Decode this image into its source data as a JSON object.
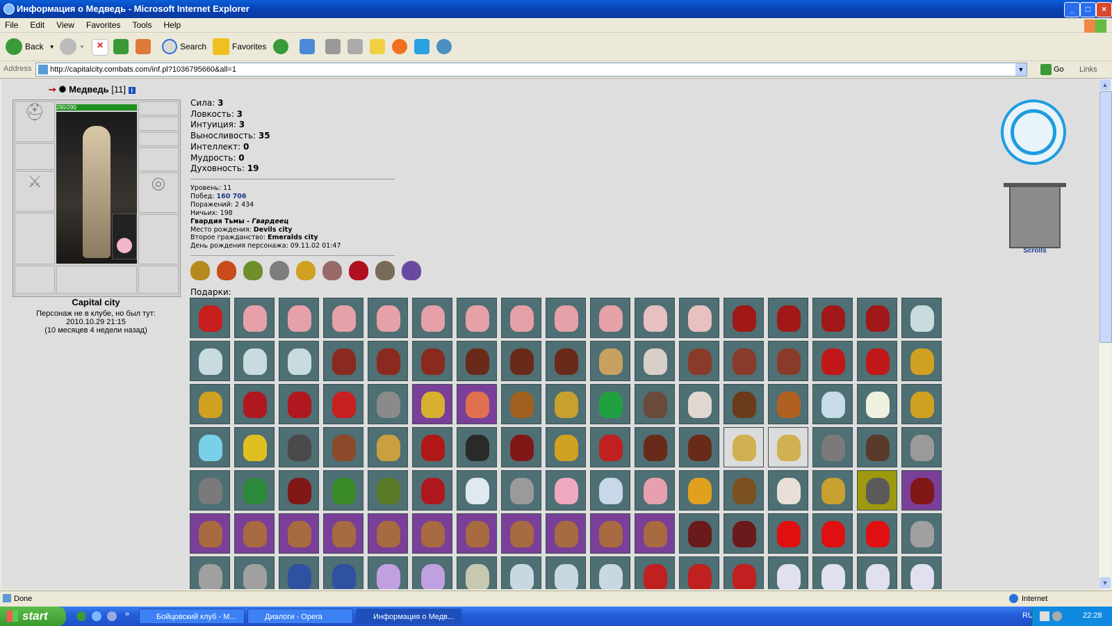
{
  "window": {
    "title": "Информация о Медведь - Microsoft Internet Explorer",
    "controls": [
      "_",
      "□",
      "×"
    ]
  },
  "menu": [
    "File",
    "Edit",
    "View",
    "Favorites",
    "Tools",
    "Help"
  ],
  "toolbar": {
    "back": "Back",
    "search": "Search",
    "favorites": "Favorites",
    "icons": [
      "back-icon",
      "forward-icon",
      "stop-icon",
      "refresh-icon",
      "home-icon",
      "search-icon",
      "favorites-icon",
      "history-icon",
      "mail-icon",
      "print-icon",
      "edit-icon",
      "notes-icon",
      "messenger-icon",
      "skype-icon",
      "people-icon"
    ]
  },
  "address": {
    "label": "Address",
    "url": "http://capitalcity.combats.com/inf.pl?1036795660&all=1",
    "go": "Go",
    "links": "Links"
  },
  "character": {
    "name": "Медведь",
    "level": "[11]",
    "hp": "290/290",
    "city": "Capital city",
    "status_line1": "Персонаж не в клубе, но был тут:",
    "status_line2": "2010.10.29 21:15",
    "status_line3": "(10 месяцев 4 недели назад)",
    "stats": [
      {
        "label": "Сила:",
        "value": "3"
      },
      {
        "label": "Ловкость:",
        "value": "3"
      },
      {
        "label": "Интуиция:",
        "value": "3"
      },
      {
        "label": "Выносливость:",
        "value": "35"
      },
      {
        "label": "Интеллект:",
        "value": "0"
      },
      {
        "label": "Мудрость:",
        "value": "0"
      },
      {
        "label": "Духовность:",
        "value": "19"
      }
    ],
    "details": [
      {
        "label": "Уровень:",
        "value": "11"
      },
      {
        "label": "Побед:",
        "value": "160 706"
      },
      {
        "label": "Поражений:",
        "value": "2 434"
      },
      {
        "label": "Ничьих:",
        "value": "198"
      },
      {
        "label": "Гвардия Тьмы - ",
        "value": "Гвардеец"
      },
      {
        "label": "Место рождения:",
        "value": "Devils city"
      },
      {
        "label": "Второе гражданство:",
        "value": "Emeralds city"
      },
      {
        "label": "День рождения персонажа:",
        "value": "09.11.02 01:47"
      }
    ],
    "badge_colors": [
      "#b58a1e",
      "#c94a1a",
      "#6e8f2a",
      "#7d7d7d",
      "#d0a020",
      "#9a6a6a",
      "#b01020",
      "#7a6a5a",
      "#6a4aa0"
    ],
    "gifts_label": "Подарки:",
    "scrolls_label": "Scrolls"
  },
  "gifts": {
    "rows": [
      [
        "#c81e1e",
        "#e6a0a8",
        "#e6a0a8",
        "#e6a0a8",
        "#e6a0a8",
        "#e6a0a8",
        "#e6a0a8",
        "#e6a0a8",
        "#e6a0a8",
        "#e6a0a8",
        "#e8c0c0",
        "#e8c0c0",
        "#a01818",
        "#a01818",
        "#a01818",
        "#a01818",
        "#c8dce0",
        "#c8dce0"
      ],
      [
        "#c8dce0",
        "#c8dce0",
        "#8a2a1e",
        "#8a2a1e",
        "#8a2a1e",
        "#6a2a1a",
        "#6a2a1a",
        "#6a2a1a",
        "#c8a060",
        "#d8d0c8",
        "#8a3a28",
        "#8a3a28",
        "#8a3a28",
        "#c01818",
        "#c01818",
        "#d0a020",
        "#d0a020",
        "#b01820"
      ],
      [
        "#b01820",
        "#c82020",
        "#8a8a8a",
        "#d8b030",
        "#e07050",
        "#a06020",
        "#c8a030",
        "#20a040",
        "#6a4a3a",
        "#e0d8d0",
        "#6a3a1a",
        "#b06020",
        "#c8dce8",
        "#f0f0e0",
        "#d0a020",
        "#7ad0e8",
        "#e0c020",
        "#4a4a4a"
      ],
      [
        "#8a4a2a",
        "#c8a040",
        "#b01818",
        "#2a2a2a",
        "#801818",
        "#d0a020",
        "#c02020",
        "#6a2a1a",
        "#6a2a1a",
        "#d0b050",
        "#d0b050",
        "#7a7a7a",
        "#5a3a2a",
        "#9a9a9a",
        "#7a7a7a",
        "#2a8a3a",
        "#801818",
        "#3a8a2a"
      ],
      [
        "#5a7a2a",
        "#b01820",
        "#e0e8f0",
        "#9a9a9a",
        "#f0a8c0",
        "#c8d8e8",
        "#e8a0b0",
        "#e0a020",
        "#7a5020",
        "#e8e0d8",
        "#c8a030",
        "#5a5a5a",
        "#801818",
        "#a86a40",
        "#a86a40",
        "#a86a40",
        "#a86a40",
        "#a86a40"
      ],
      [
        "#a86a40",
        "#a86a40",
        "#a86a40",
        "#a86a40",
        "#a86a40",
        "#a86a40",
        "#6a1a1a",
        "#6a1a1a",
        "#e01010",
        "#e01010",
        "#e01010",
        "#a0a0a0",
        "#a0a0a0",
        "#a0a0a0",
        "#3050a0",
        "#3050a0",
        "#c0a0e0",
        "#c0a0e0"
      ],
      [
        "#c8c8b0",
        "#c8d8e0",
        "#c8d8e0",
        "#c8d8e0",
        "#c02020",
        "#c02020",
        "#c02020",
        "#e0e0f0",
        "#e0e0f0",
        "#e0e0f0",
        "#e0e0f0",
        "#e0e0f0",
        "#f0e0b0",
        "#f0e0b0",
        "#f0e0b0",
        "#6a6a6a",
        "#c8c8c8",
        "#c8b890"
      ]
    ],
    "bg": [
      [
        "t",
        "t",
        "t",
        "t",
        "t",
        "t",
        "t",
        "t",
        "t",
        "t",
        "t",
        "t",
        "t",
        "t",
        "t",
        "t",
        "t",
        "t"
      ],
      [
        "t",
        "t",
        "t",
        "t",
        "t",
        "t",
        "t",
        "t",
        "t",
        "t",
        "t",
        "t",
        "t",
        "t",
        "t",
        "t",
        "t",
        "t"
      ],
      [
        "t",
        "t",
        "t",
        "p",
        "p",
        "t",
        "t",
        "t",
        "t",
        "t",
        "t",
        "t",
        "t",
        "t",
        "t",
        "t",
        "t",
        "t"
      ],
      [
        "t",
        "t",
        "t",
        "t",
        "t",
        "t",
        "t",
        "t",
        "t",
        "w",
        "w",
        "t",
        "t",
        "t",
        "t",
        "t",
        "t",
        "t"
      ],
      [
        "t",
        "t",
        "t",
        "t",
        "t",
        "t",
        "t",
        "t",
        "t",
        "t",
        "t",
        "y",
        "p",
        "p",
        "p",
        "p",
        "p",
        "p"
      ],
      [
        "p",
        "p",
        "p",
        "p",
        "p",
        "p",
        "t",
        "t",
        "t",
        "t",
        "t",
        "t",
        "t",
        "t",
        "t",
        "t",
        "t",
        "t"
      ],
      [
        "t",
        "t",
        "t",
        "t",
        "t",
        "t",
        "t",
        "t",
        "t",
        "t",
        "t",
        "t",
        "t",
        "t",
        "t",
        "t",
        "t",
        "t"
      ]
    ]
  },
  "status": {
    "text": "Done",
    "zone": "Internet"
  },
  "taskbar": {
    "start": "start",
    "tasks": [
      "Бойцовский клуб - M...",
      "Диалоги - Opera",
      "Информация о Медв..."
    ],
    "lang": "RU",
    "time": "22:28"
  }
}
